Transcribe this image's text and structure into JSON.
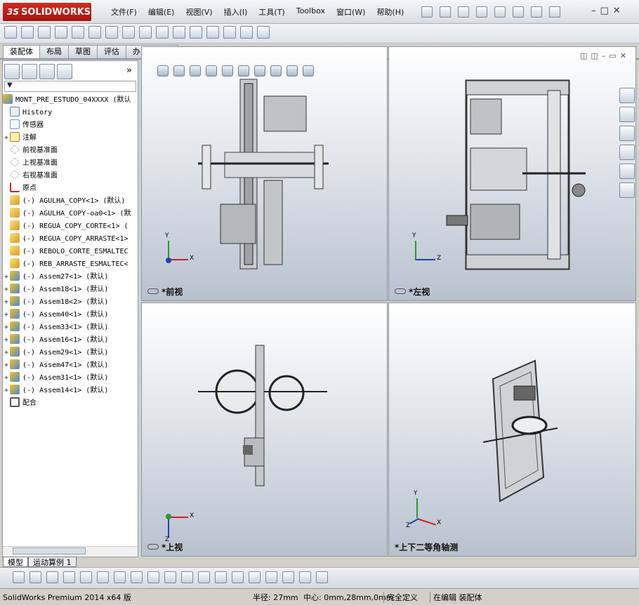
{
  "app": {
    "brand_prefix": "3S",
    "brand": "SOLIDWORKS"
  },
  "menu": [
    "文件(F)",
    "编辑(E)",
    "视图(V)",
    "插入(I)",
    "工具(T)",
    "Toolbox",
    "窗口(W)",
    "帮助(H)"
  ],
  "window_controls": [
    "–",
    "□",
    "✕"
  ],
  "tabs": [
    "装配体",
    "布局",
    "草图",
    "评估",
    "办公室产品"
  ],
  "filter_icon": "▼",
  "tree": {
    "root": "MONT_PRE_ESTUDO_04XXXX  (默认",
    "items": [
      {
        "label": "History",
        "icon": "history-icon",
        "expand": ""
      },
      {
        "label": "传感器",
        "icon": "sensor-icon",
        "expand": ""
      },
      {
        "label": "注解",
        "icon": "annotation-icon",
        "expand": "+"
      },
      {
        "label": "前视基准面",
        "icon": "plane-icon",
        "expand": ""
      },
      {
        "label": "上视基准面",
        "icon": "plane-icon",
        "expand": ""
      },
      {
        "label": "右视基准面",
        "icon": "plane-icon",
        "expand": ""
      },
      {
        "label": "原点",
        "icon": "origin-icon",
        "expand": ""
      },
      {
        "label": "(-) AGULHA_COPY<1> (默认)",
        "icon": "part-icon",
        "expand": ""
      },
      {
        "label": "(-) AGULHA_COPY-oa0<1> (默",
        "icon": "part-icon",
        "expand": ""
      },
      {
        "label": "(-) REGUA_COPY_CORTE<1> (",
        "icon": "part-icon",
        "expand": ""
      },
      {
        "label": "(-) REGUA_COPY_ARRASTE<1>",
        "icon": "part-icon",
        "expand": ""
      },
      {
        "label": "(-) REBOLO_CORTE_ESMALTEC",
        "icon": "part-icon",
        "expand": ""
      },
      {
        "label": "(-) REB_ARRASTE_ESMALTEC<",
        "icon": "part-icon",
        "expand": ""
      },
      {
        "label": "(-) Assem27<1> (默认)",
        "icon": "assembly-icon",
        "expand": "+"
      },
      {
        "label": "(-) Assem18<1> (默认)",
        "icon": "assembly-icon",
        "expand": "+"
      },
      {
        "label": "(-) Assem18<2> (默认)",
        "icon": "assembly-icon",
        "expand": "+"
      },
      {
        "label": "(-) Assem40<1> (默认)",
        "icon": "assembly-icon",
        "expand": "+"
      },
      {
        "label": "(-) Assem33<1> (默认)",
        "icon": "assembly-icon",
        "expand": "+"
      },
      {
        "label": "(-) Assem16<1> (默认)",
        "icon": "assembly-icon",
        "expand": "+"
      },
      {
        "label": "(-) Assem29<1> (默认)",
        "icon": "assembly-icon",
        "expand": "+"
      },
      {
        "label": "(-) Assem47<1> (默认)",
        "icon": "assembly-icon",
        "expand": "+"
      },
      {
        "label": "(-) Assem31<1> (默认)",
        "icon": "assembly-icon",
        "expand": "+"
      },
      {
        "label": "(-) Assem14<1> (默认)",
        "icon": "assembly-icon",
        "expand": "+"
      },
      {
        "label": "配合",
        "icon": "mate-icon",
        "expand": ""
      }
    ]
  },
  "bottom_tabs": [
    "模型",
    "运动算例 1"
  ],
  "panel_expand": "»",
  "viewports": [
    {
      "label": "*前视",
      "axis_a": "Y",
      "axis_b": "X"
    },
    {
      "label": "*左视",
      "axis_a": "Y",
      "axis_b": "Z"
    },
    {
      "label": "*上视",
      "axis_a": "Z",
      "axis_b": "X"
    },
    {
      "label": "*上下二等角轴测",
      "axis_a": "Y",
      "axis_b": "X",
      "axis_c": "Z"
    }
  ],
  "status": {
    "product": "SolidWorks Premium 2014 x64 版",
    "radius": "半径: 27mm",
    "center": "中心: 0mm,28mm,0mm",
    "defined": "完全定义",
    "editing": "在编辑 装配体"
  }
}
